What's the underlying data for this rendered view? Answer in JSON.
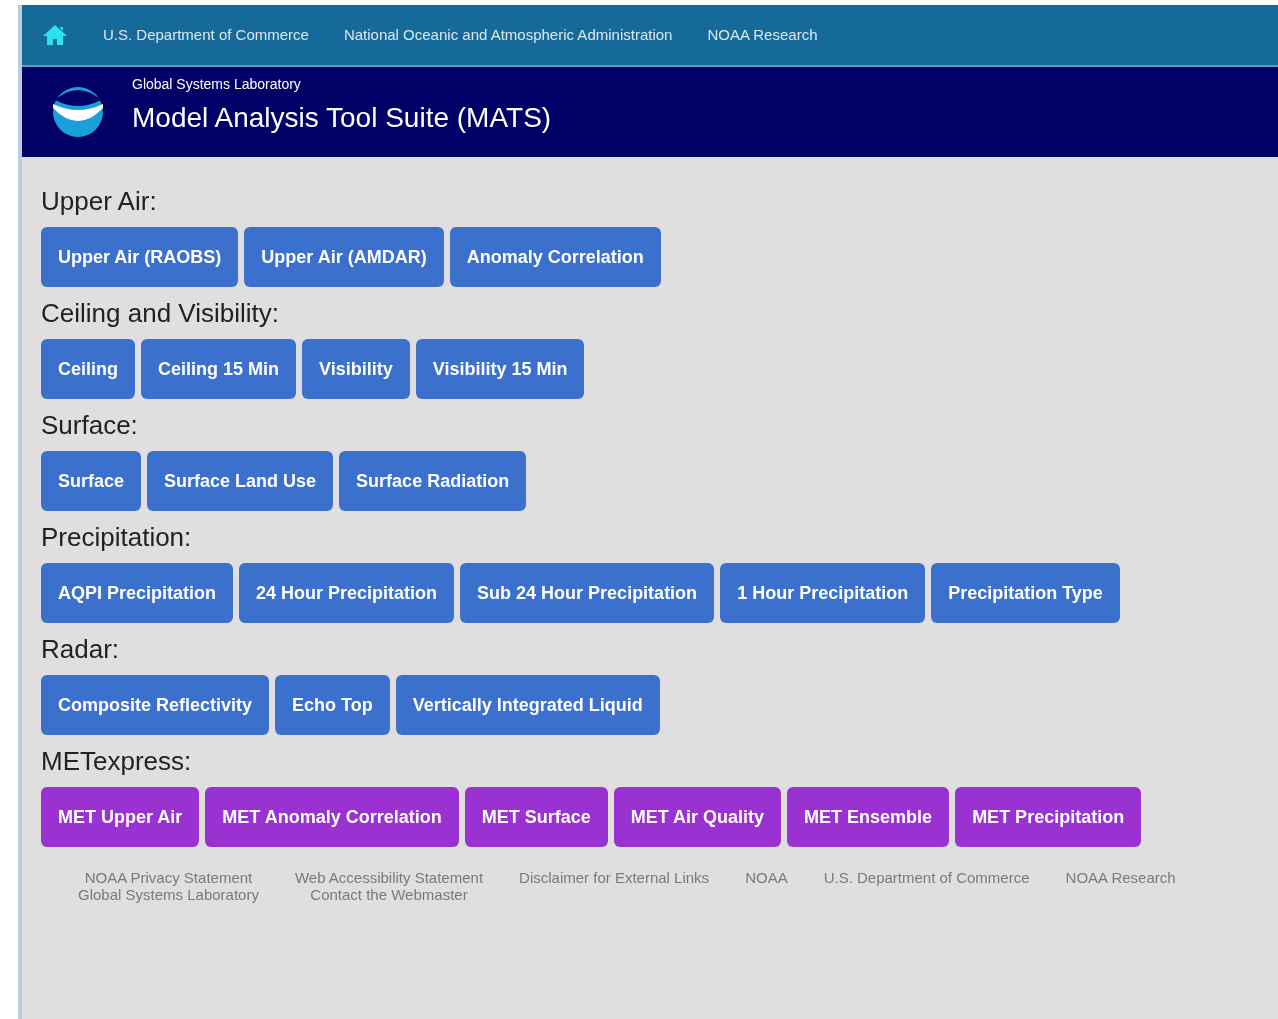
{
  "top_bar": {
    "links": [
      "U.S. Department of Commerce",
      "National Oceanic and Atmospheric Administration",
      "NOAA Research"
    ]
  },
  "header": {
    "subtitle": "Global Systems Laboratory",
    "title": "Model Analysis Tool Suite (MATS)"
  },
  "sections": [
    {
      "heading": "Upper Air:",
      "kind": "standard",
      "buttons": [
        "Upper Air (RAOBS)",
        "Upper Air (AMDAR)",
        "Anomaly Correlation"
      ]
    },
    {
      "heading": "Ceiling and Visibility:",
      "kind": "standard",
      "buttons": [
        "Ceiling",
        "Ceiling 15 Min",
        "Visibility",
        "Visibility 15 Min"
      ]
    },
    {
      "heading": "Surface:",
      "kind": "standard",
      "buttons": [
        "Surface",
        "Surface Land Use",
        "Surface Radiation"
      ]
    },
    {
      "heading": "Precipitation:",
      "kind": "standard",
      "buttons": [
        "AQPI Precipitation",
        "24 Hour Precipitation",
        "Sub 24 Hour Precipitation",
        "1 Hour Precipitation",
        "Precipitation Type"
      ]
    },
    {
      "heading": "Radar:",
      "kind": "standard",
      "buttons": [
        "Composite Reflectivity",
        "Echo Top",
        "Vertically Integrated Liquid"
      ]
    },
    {
      "heading": "METexpress:",
      "kind": "met",
      "buttons": [
        "MET Upper Air",
        "MET Anomaly Correlation",
        "MET Surface",
        "MET Air Quality",
        "MET Ensemble",
        "MET Precipitation"
      ]
    }
  ],
  "footer": {
    "columns": [
      [
        "NOAA Privacy Statement",
        "Global Systems Laboratory"
      ],
      [
        "Web Accessibility Statement",
        "Contact the Webmaster"
      ],
      [
        "Disclaimer for External Links"
      ],
      [
        "NOAA"
      ],
      [
        "U.S. Department of Commerce"
      ],
      [
        "NOAA Research"
      ]
    ]
  }
}
